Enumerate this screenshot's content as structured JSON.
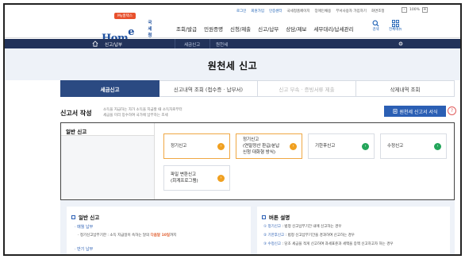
{
  "util": {
    "links": [
      "로그인",
      "회원가입",
      "인증센터",
      "국세청홈페이지",
      "장애인채용",
      "부서사용자 가입하기",
      "화면조정"
    ],
    "font_minus": "-",
    "font_pct": "100%",
    "font_plus": "+"
  },
  "logo": {
    "badge": "My홈택스",
    "hom": "Hom",
    "tax": "e tax",
    "kr": "국세청홈택스"
  },
  "gnb": [
    "조회/발급",
    "민원증명",
    "신청/제출",
    "신고/납부",
    "상담/제보",
    "세무대리/납세관리"
  ],
  "header_icons": {
    "search": "검색",
    "menu": "전체메뉴"
  },
  "navbar": {
    "crumb1": "신고/납부",
    "crumb2": "세금신고",
    "crumb3": "원천세"
  },
  "page_title": "원천세 신고",
  "tabs": [
    {
      "label": "세금신고"
    },
    {
      "label": "신고내역 조회 (접수증 · 납부서)"
    },
    {
      "label": "신고 부속 · 증빙서류 제출"
    },
    {
      "label": "삭제내역 조회"
    }
  ],
  "section": {
    "title": "신고서 작성",
    "desc_line1": "소득을 지급하는 자가 소득을 지급할 때 소득자로부터",
    "desc_line2": "세금을 미리 징수하여 국가에 납부하는 조세",
    "write_button": "원천세 신고서 서식",
    "help": "?"
  },
  "box": {
    "left_head": "일반 신고",
    "cards": [
      {
        "line1": "정기신고",
        "line2": "",
        "line3": "",
        "arrow": "›"
      },
      {
        "line1": "정기신고",
        "line2": "(연말정산 환급/분납",
        "line3": "신청 대화형 방식)",
        "arrow": "›"
      },
      {
        "line1": "기한후신고",
        "line2": "",
        "line3": "",
        "arrow": "›"
      },
      {
        "line1": "수정신고",
        "line2": "",
        "line3": "",
        "arrow": "›"
      },
      {
        "line1": "파일 변환신고",
        "line2": "(회계프로그램)",
        "line3": "",
        "arrow": "›"
      }
    ]
  },
  "bottom": {
    "left_head": "일반 신고",
    "left_sub1": "· 매월 납부",
    "left_line1_a": "· 정기신고납부기한 : 소득 지급일이 속하는 달의 ",
    "left_line1_b": "다음달 10일",
    "left_line1_c": "까지",
    "left_sub2": "· 반기 납부",
    "right_head": "버튼 설명",
    "right_lines": [
      {
        "num": "①",
        "key": "정기신고",
        "text": " : 법정 신고납부기간 내에 신고하는 경우"
      },
      {
        "num": "②",
        "key": "기한후신고",
        "text": " : 법정 신고납부기간을 경과하여 신고하는 경우"
      },
      {
        "num": "③",
        "key": "수정신고",
        "text": " : 당초 세금을 적게 신고하여 과세표준과 세액을 증액 신고하고자 하는 경우"
      }
    ]
  }
}
